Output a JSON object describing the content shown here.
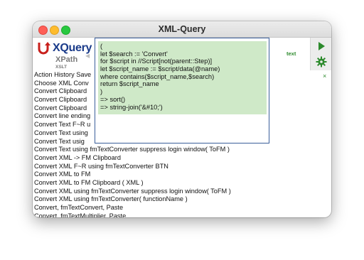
{
  "window": {
    "title": "XML-Query"
  },
  "logo": {
    "title": "XQuery",
    "subtitle": "XPath",
    "caption": "XSLT"
  },
  "toolbar": {
    "mode_label": "text",
    "run_icon": "play-icon",
    "settings_icon": "gear-icon",
    "close_icon": "close-icon",
    "close_glyph": "×"
  },
  "list": {
    "items": [
      "Action History Save",
      "Choose XML Conv",
      "Convert Clipboard",
      "Convert Clipboard",
      "Convert Clipboard",
      "Convert line ending",
      "Convert Text F~R u",
      "Convert Text using",
      "Convert Text usig",
      "Convert Text using fmTextConverter suppress login window( ToFM )",
      "Convert XML -> FM Clipboard",
      "Convert XML F~R using fmTextConverter BTN",
      "Convert XML to FM",
      "Convert XML to FM Clipboard ( XML )",
      "Convert XML using fmTextConverter suppress login window( ToFM )",
      "Convert XML using fmTextConverter( functionName )",
      "Convert, fmTextConvert, Paste",
      "Convert, fmTextMultiplier, Paste"
    ]
  },
  "editor": {
    "lines": [
      "(",
      "let $search := 'Convert'",
      "for $script in //Script[not(parent::Step)]",
      "let $script_name := $script/data(@name)",
      "where contains($script_name,$search)",
      "return $script_name",
      ")",
      "=> sort()",
      "=> string-join('&#10;')"
    ]
  },
  "colors": {
    "accent": "#1a3b8a",
    "code_bg": "#cfe9c8",
    "green": "#2c8a2c"
  }
}
